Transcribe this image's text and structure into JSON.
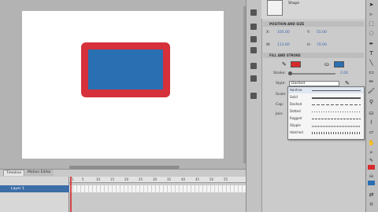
{
  "panel": {
    "header_label": "Shape",
    "section_position": "POSITION AND SIZE",
    "section_fill_stroke": "FILL AND STROKE",
    "pos_x_label": "X:",
    "pos_x_value": "105.00",
    "pos_y_label": "Y:",
    "pos_y_value": "55.00",
    "width_label": "W:",
    "width_value": "113.00",
    "height_label": "H:",
    "height_value": "70.00",
    "stroke_label": "Stroke:",
    "stroke_value": "2.00",
    "style_label": "Style:",
    "style_value": "Dashed",
    "scale_label": "Scale:",
    "cap_label": "Cap:",
    "join_label": "Join:"
  },
  "style_options": [
    "Hairline",
    "Solid",
    "Dashed",
    "Dotted",
    "Ragged",
    "Stipple",
    "Hatched"
  ],
  "timeline": {
    "tab_timeline": "Timeline",
    "tab_motion": "Motion Editor",
    "layer_name": "Layer 1",
    "ruler_ticks": [
      "1",
      "5",
      "10",
      "15",
      "20",
      "25",
      "30",
      "35",
      "40",
      "45",
      "50",
      "55"
    ]
  },
  "colors": {
    "stroke": "#d72a2a",
    "fill": "#2a6fb2",
    "stage": "#ffffff",
    "selection": "#3d6ea8"
  },
  "tools": [
    "selection-tool",
    "subselection-tool",
    "free-transform-tool",
    "lasso-tool",
    "pen-tool",
    "text-tool",
    "line-tool",
    "rectangle-tool",
    "pencil-tool",
    "brush-tool",
    "bone-tool",
    "paint-bucket-tool",
    "eyedropper-tool",
    "eraser-tool",
    "hand-tool",
    "zoom-tool"
  ]
}
